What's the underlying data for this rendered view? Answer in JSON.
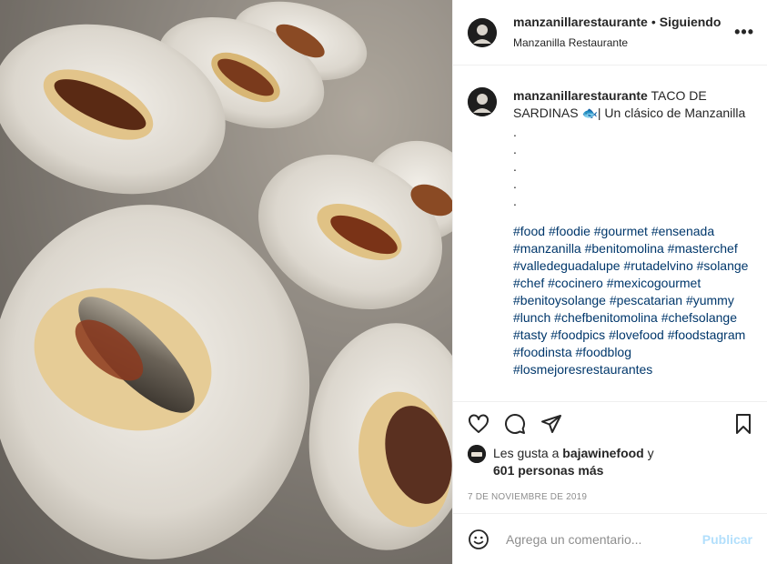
{
  "post": {
    "username": "manzanillarestaurante",
    "separator": "•",
    "following_label": "Siguiendo",
    "location": "Manzanilla Restaurante",
    "more_label": "•••"
  },
  "caption": {
    "username": "manzanillarestaurante",
    "text": "TACO DE SARDINAS 🐟| Un clásico de Manzanilla",
    "dots": [
      ".",
      ".",
      ".",
      ".",
      "."
    ],
    "hashtags": [
      "#food",
      "#foodie",
      "#gourmet",
      "#ensenada",
      "#manzanilla",
      "#benitomolina",
      "#masterchef",
      "#valledeguadalupe",
      "#rutadelvino",
      "#solange",
      "#chef",
      "#cocinero",
      "#mexicogourmet",
      "#benitoysolange",
      "#pescatarian",
      "#yummy",
      "#lunch",
      "#chefbenitomolina",
      "#chefsolange",
      "#tasty",
      "#foodpics",
      "#lovefood",
      "#foodstagram",
      "#foodinsta",
      "#foodblog",
      "#losmejoresrestaurantes"
    ]
  },
  "actions": {
    "like_icon": "heart-icon",
    "comment_icon": "comment-icon",
    "share_icon": "paper-plane-icon",
    "save_icon": "bookmark-icon"
  },
  "likes": {
    "prefix": "Les gusta a",
    "user": "bajawinefood",
    "conjunction": "y",
    "others": "601 personas más"
  },
  "date": "7 de noviembre de 2019",
  "comment_box": {
    "placeholder": "Agrega un comentario...",
    "publish_label": "Publicar",
    "emoji_icon": "smile-icon"
  },
  "colors": {
    "text": "#262626",
    "hashtag": "#00376b",
    "muted": "#8e8e8e",
    "publish_disabled": "#b2dffc",
    "border": "#efefef"
  }
}
